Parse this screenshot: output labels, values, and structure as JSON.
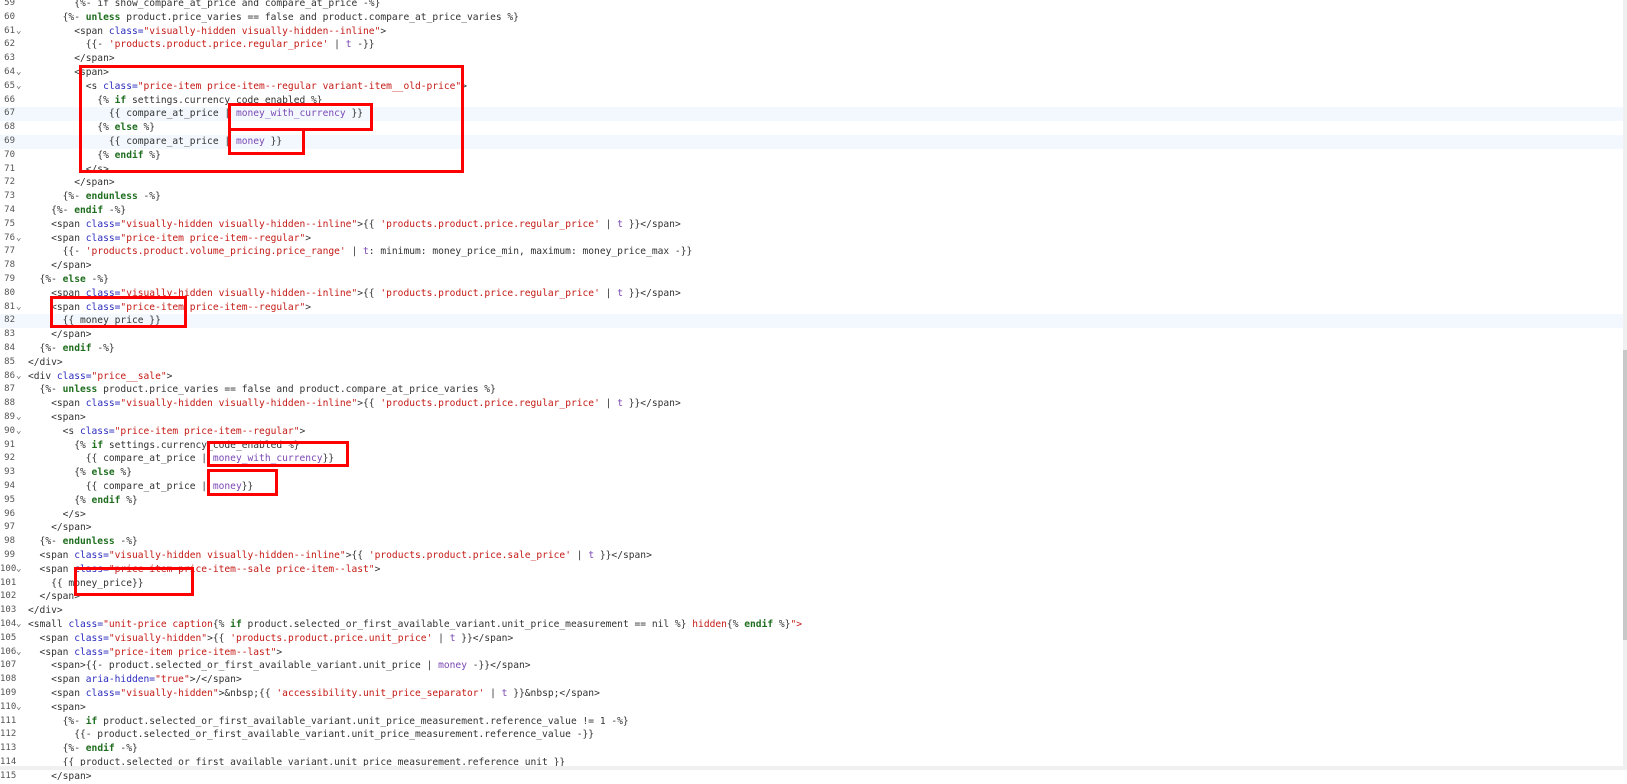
{
  "editor": {
    "lines": [
      {
        "n": "59",
        "fold": "",
        "hl": false,
        "segs": [
          [
            "        ",
            "liq"
          ],
          [
            "{%- if show_compare_at_price and compare_at_price -%}",
            "liq"
          ]
        ]
      },
      {
        "n": "60",
        "fold": "",
        "hl": false,
        "segs": [
          [
            "      {%- ",
            "liq"
          ],
          [
            "unless",
            "kw"
          ],
          [
            " product.price_varies == false and product.compare_at_price_varies %}",
            "liq"
          ]
        ]
      },
      {
        "n": "61",
        "fold": "⌄",
        "hl": false,
        "segs": [
          [
            "        <span ",
            "tag"
          ],
          [
            "class=",
            "attr"
          ],
          [
            "\"visually-hidden visually-hidden--inline\"",
            "str"
          ],
          [
            ">",
            "tag"
          ]
        ]
      },
      {
        "n": "62",
        "fold": "",
        "hl": false,
        "segs": [
          [
            "          {{- ",
            "liq"
          ],
          [
            "'products.product.price.regular_price'",
            "str"
          ],
          [
            " | ",
            "liq"
          ],
          [
            "t",
            "filter"
          ],
          [
            " -}}",
            "liq"
          ]
        ]
      },
      {
        "n": "63",
        "fold": "",
        "hl": false,
        "segs": [
          [
            "        </span>",
            "tag"
          ]
        ]
      },
      {
        "n": "64",
        "fold": "⌄",
        "hl": false,
        "segs": [
          [
            "        <span>",
            "tag"
          ]
        ]
      },
      {
        "n": "65",
        "fold": "⌄",
        "hl": false,
        "segs": [
          [
            "          <s ",
            "tag"
          ],
          [
            "class=",
            "attr"
          ],
          [
            "\"price-item price-item--regular variant-item__old-price\"",
            "str"
          ],
          [
            ">",
            "tag"
          ]
        ]
      },
      {
        "n": "66",
        "fold": "",
        "hl": false,
        "segs": [
          [
            "            {% ",
            "liq"
          ],
          [
            "if",
            "kw"
          ],
          [
            " settings.currency_code_enabled %}",
            "liq"
          ]
        ]
      },
      {
        "n": "67",
        "fold": "",
        "hl": true,
        "segs": [
          [
            "              {{ compare_at_price | ",
            "liq"
          ],
          [
            "money_with_currency",
            "filter"
          ],
          [
            " }}",
            "liq"
          ]
        ]
      },
      {
        "n": "68",
        "fold": "",
        "hl": false,
        "segs": [
          [
            "            {% ",
            "liq"
          ],
          [
            "else",
            "kw"
          ],
          [
            " %}",
            "liq"
          ]
        ]
      },
      {
        "n": "69",
        "fold": "",
        "hl": true,
        "segs": [
          [
            "              {{ compare_at_price | ",
            "liq"
          ],
          [
            "money",
            "filter"
          ],
          [
            " }}",
            "liq"
          ]
        ]
      },
      {
        "n": "70",
        "fold": "",
        "hl": false,
        "segs": [
          [
            "            {% ",
            "liq"
          ],
          [
            "endif",
            "kw"
          ],
          [
            " %}",
            "liq"
          ]
        ]
      },
      {
        "n": "71",
        "fold": "",
        "hl": false,
        "segs": [
          [
            "          </s>",
            "tag"
          ]
        ]
      },
      {
        "n": "72",
        "fold": "",
        "hl": false,
        "segs": [
          [
            "        </span>",
            "tag"
          ]
        ]
      },
      {
        "n": "73",
        "fold": "",
        "hl": false,
        "segs": [
          [
            "      {%- ",
            "liq"
          ],
          [
            "endunless",
            "kw"
          ],
          [
            " -%}",
            "liq"
          ]
        ]
      },
      {
        "n": "74",
        "fold": "",
        "hl": false,
        "segs": [
          [
            "    {%- ",
            "liq"
          ],
          [
            "endif",
            "kw"
          ],
          [
            " -%}",
            "liq"
          ]
        ]
      },
      {
        "n": "75",
        "fold": "",
        "hl": false,
        "segs": [
          [
            "    <span ",
            "tag"
          ],
          [
            "class=",
            "attr"
          ],
          [
            "\"visually-hidden visually-hidden--inline\"",
            "str"
          ],
          [
            ">{{ ",
            "tag"
          ],
          [
            "'products.product.price.regular_price'",
            "str"
          ],
          [
            " | ",
            "liq"
          ],
          [
            "t",
            "filter"
          ],
          [
            " }}</span>",
            "tag"
          ]
        ]
      },
      {
        "n": "76",
        "fold": "⌄",
        "hl": false,
        "segs": [
          [
            "    <span ",
            "tag"
          ],
          [
            "class=",
            "attr"
          ],
          [
            "\"price-item price-item--regular\"",
            "str"
          ],
          [
            ">",
            "tag"
          ]
        ]
      },
      {
        "n": "77",
        "fold": "",
        "hl": false,
        "segs": [
          [
            "      {{- ",
            "liq"
          ],
          [
            "'products.product.volume_pricing.price_range'",
            "str"
          ],
          [
            " | ",
            "liq"
          ],
          [
            "t",
            "filter"
          ],
          [
            ": minimum: money_price_min, maximum: money_price_max -}}",
            "liq"
          ]
        ]
      },
      {
        "n": "78",
        "fold": "",
        "hl": false,
        "segs": [
          [
            "    </span>",
            "tag"
          ]
        ]
      },
      {
        "n": "79",
        "fold": "",
        "hl": false,
        "segs": [
          [
            "  {%- ",
            "liq"
          ],
          [
            "else",
            "kw"
          ],
          [
            " -%}",
            "liq"
          ]
        ]
      },
      {
        "n": "80",
        "fold": "",
        "hl": false,
        "segs": [
          [
            "    <span ",
            "tag"
          ],
          [
            "class=",
            "attr"
          ],
          [
            "\"visually-hidden visually-hidden--inline\"",
            "str"
          ],
          [
            ">{{ ",
            "tag"
          ],
          [
            "'products.product.price.regular_price'",
            "str"
          ],
          [
            " | ",
            "liq"
          ],
          [
            "t",
            "filter"
          ],
          [
            " }}</span>",
            "tag"
          ]
        ]
      },
      {
        "n": "81",
        "fold": "⌄",
        "hl": false,
        "segs": [
          [
            "    <span ",
            "tag"
          ],
          [
            "class=",
            "attr"
          ],
          [
            "\"price-item price-item--regular\"",
            "str"
          ],
          [
            ">",
            "tag"
          ]
        ]
      },
      {
        "n": "82",
        "fold": "",
        "hl": true,
        "segs": [
          [
            "      {{ money_price }}",
            "liq"
          ]
        ]
      },
      {
        "n": "83",
        "fold": "",
        "hl": false,
        "segs": [
          [
            "    </span>",
            "tag"
          ]
        ]
      },
      {
        "n": "84",
        "fold": "",
        "hl": false,
        "segs": [
          [
            "  {%- ",
            "liq"
          ],
          [
            "endif",
            "kw"
          ],
          [
            " -%}",
            "liq"
          ]
        ]
      },
      {
        "n": "85",
        "fold": "",
        "hl": false,
        "segs": [
          [
            "</div>",
            "tag"
          ]
        ]
      },
      {
        "n": "86",
        "fold": "⌄",
        "hl": false,
        "segs": [
          [
            "<div ",
            "tag"
          ],
          [
            "class=",
            "attr"
          ],
          [
            "\"price__sale\"",
            "str"
          ],
          [
            ">",
            "tag"
          ]
        ]
      },
      {
        "n": "87",
        "fold": "",
        "hl": false,
        "segs": [
          [
            "  {%- ",
            "liq"
          ],
          [
            "unless",
            "kw"
          ],
          [
            " product.price_varies == false and product.compare_at_price_varies %}",
            "liq"
          ]
        ]
      },
      {
        "n": "88",
        "fold": "",
        "hl": false,
        "segs": [
          [
            "    <span ",
            "tag"
          ],
          [
            "class=",
            "attr"
          ],
          [
            "\"visually-hidden visually-hidden--inline\"",
            "str"
          ],
          [
            ">{{ ",
            "tag"
          ],
          [
            "'products.product.price.regular_price'",
            "str"
          ],
          [
            " | ",
            "liq"
          ],
          [
            "t",
            "filter"
          ],
          [
            " }}</span>",
            "tag"
          ]
        ]
      },
      {
        "n": "89",
        "fold": "⌄",
        "hl": false,
        "segs": [
          [
            "    <span>",
            "tag"
          ]
        ]
      },
      {
        "n": "90",
        "fold": "⌄",
        "hl": false,
        "segs": [
          [
            "      <s ",
            "tag"
          ],
          [
            "class=",
            "attr"
          ],
          [
            "\"price-item price-item--regular\"",
            "str"
          ],
          [
            ">",
            "tag"
          ]
        ]
      },
      {
        "n": "91",
        "fold": "",
        "hl": false,
        "segs": [
          [
            "        {% ",
            "liq"
          ],
          [
            "if",
            "kw"
          ],
          [
            " settings.currency_code_enabled %}",
            "liq"
          ]
        ]
      },
      {
        "n": "92",
        "fold": "",
        "hl": false,
        "segs": [
          [
            "          {{ compare_at_price | ",
            "liq"
          ],
          [
            "money_with_currency",
            "filter"
          ],
          [
            "}}",
            "liq"
          ]
        ]
      },
      {
        "n": "93",
        "fold": "",
        "hl": false,
        "segs": [
          [
            "        {% ",
            "liq"
          ],
          [
            "else",
            "kw"
          ],
          [
            " %}",
            "liq"
          ]
        ]
      },
      {
        "n": "94",
        "fold": "",
        "hl": false,
        "segs": [
          [
            "          {{ compare_at_price | ",
            "liq"
          ],
          [
            "money",
            "filter"
          ],
          [
            "}}",
            "liq"
          ]
        ]
      },
      {
        "n": "95",
        "fold": "",
        "hl": false,
        "segs": [
          [
            "        {% ",
            "liq"
          ],
          [
            "endif",
            "kw"
          ],
          [
            " %}",
            "liq"
          ]
        ]
      },
      {
        "n": "96",
        "fold": "",
        "hl": false,
        "segs": [
          [
            "      </s>",
            "tag"
          ]
        ]
      },
      {
        "n": "97",
        "fold": "",
        "hl": false,
        "segs": [
          [
            "    </span>",
            "tag"
          ]
        ]
      },
      {
        "n": "98",
        "fold": "",
        "hl": false,
        "segs": [
          [
            "  {%- ",
            "liq"
          ],
          [
            "endunless",
            "kw"
          ],
          [
            " -%}",
            "liq"
          ]
        ]
      },
      {
        "n": "99",
        "fold": "",
        "hl": false,
        "segs": [
          [
            "  <span ",
            "tag"
          ],
          [
            "class=",
            "attr"
          ],
          [
            "\"visually-hidden visually-hidden--inline\"",
            "str"
          ],
          [
            ">{{ ",
            "tag"
          ],
          [
            "'products.product.price.sale_price'",
            "str"
          ],
          [
            " | ",
            "liq"
          ],
          [
            "t",
            "filter"
          ],
          [
            " }}</span>",
            "tag"
          ]
        ]
      },
      {
        "n": "100",
        "fold": "⌄",
        "hl": false,
        "segs": [
          [
            "  <span ",
            "tag"
          ],
          [
            "class=",
            "attr"
          ],
          [
            "\"price-item price-item--sale price-item--last\"",
            "str"
          ],
          [
            ">",
            "tag"
          ]
        ]
      },
      {
        "n": "101",
        "fold": "",
        "hl": false,
        "segs": [
          [
            "    {{ money_price}}",
            "liq"
          ]
        ]
      },
      {
        "n": "102",
        "fold": "",
        "hl": false,
        "segs": [
          [
            "  </span>",
            "tag"
          ]
        ]
      },
      {
        "n": "103",
        "fold": "",
        "hl": false,
        "segs": [
          [
            "</div>",
            "tag"
          ]
        ]
      },
      {
        "n": "104",
        "fold": "⌄",
        "hl": false,
        "segs": [
          [
            "<small ",
            "tag"
          ],
          [
            "class=",
            "attr"
          ],
          [
            "\"unit-price caption",
            "str"
          ],
          [
            "{% ",
            "liq"
          ],
          [
            "if",
            "kw"
          ],
          [
            " product.selected_or_first_available_variant.unit_price_measurement == nil %} ",
            "liq"
          ],
          [
            "hidden",
            "str"
          ],
          [
            "{% ",
            "liq"
          ],
          [
            "endif",
            "kw"
          ],
          [
            " %}",
            "liq"
          ],
          [
            "\">",
            "str"
          ]
        ]
      },
      {
        "n": "105",
        "fold": "",
        "hl": false,
        "segs": [
          [
            "  <span ",
            "tag"
          ],
          [
            "class=",
            "attr"
          ],
          [
            "\"visually-hidden\"",
            "str"
          ],
          [
            ">{{ ",
            "tag"
          ],
          [
            "'products.product.price.unit_price'",
            "str"
          ],
          [
            " | ",
            "liq"
          ],
          [
            "t",
            "filter"
          ],
          [
            " }}</span>",
            "tag"
          ]
        ]
      },
      {
        "n": "106",
        "fold": "⌄",
        "hl": false,
        "segs": [
          [
            "  <span ",
            "tag"
          ],
          [
            "class=",
            "attr"
          ],
          [
            "\"price-item price-item--last\"",
            "str"
          ],
          [
            ">",
            "tag"
          ]
        ]
      },
      {
        "n": "107",
        "fold": "",
        "hl": false,
        "segs": [
          [
            "    <span>{{- product.selected_or_first_available_variant.unit_price | ",
            "tag"
          ],
          [
            "money",
            "filter"
          ],
          [
            " -}}</span>",
            "tag"
          ]
        ]
      },
      {
        "n": "108",
        "fold": "",
        "hl": false,
        "segs": [
          [
            "    <span ",
            "tag"
          ],
          [
            "aria-hidden=",
            "attr"
          ],
          [
            "\"true\"",
            "str"
          ],
          [
            ">/</span>",
            "tag"
          ]
        ]
      },
      {
        "n": "109",
        "fold": "",
        "hl": false,
        "segs": [
          [
            "    <span ",
            "tag"
          ],
          [
            "class=",
            "attr"
          ],
          [
            "\"visually-hidden\"",
            "str"
          ],
          [
            ">&nbsp;{{ ",
            "tag"
          ],
          [
            "'accessibility.unit_price_separator'",
            "str"
          ],
          [
            " | ",
            "liq"
          ],
          [
            "t",
            "filter"
          ],
          [
            " }}&nbsp;</span>",
            "tag"
          ]
        ]
      },
      {
        "n": "110",
        "fold": "⌄",
        "hl": false,
        "segs": [
          [
            "    <span>",
            "tag"
          ]
        ]
      },
      {
        "n": "111",
        "fold": "",
        "hl": false,
        "segs": [
          [
            "      {%- ",
            "liq"
          ],
          [
            "if",
            "kw"
          ],
          [
            " product.selected_or_first_available_variant.unit_price_measurement.reference_value != 1 -%}",
            "liq"
          ]
        ]
      },
      {
        "n": "112",
        "fold": "",
        "hl": false,
        "segs": [
          [
            "        {{- product.selected_or_first_available_variant.unit_price_measurement.reference_value -}}",
            "liq"
          ]
        ]
      },
      {
        "n": "113",
        "fold": "",
        "hl": false,
        "segs": [
          [
            "      {%- ",
            "liq"
          ],
          [
            "endif",
            "kw"
          ],
          [
            " -%}",
            "liq"
          ]
        ]
      },
      {
        "n": "114",
        "fold": "",
        "hl": false,
        "segs": [
          [
            "      {{ product.selected_or_first_available_variant.unit_price_measurement.reference_unit }}",
            "liq"
          ]
        ]
      },
      {
        "n": "115",
        "fold": "",
        "hl": false,
        "segs": [
          [
            "    </span>",
            "tag"
          ]
        ]
      }
    ]
  },
  "colors": {
    "annotation_box": "#ff0000",
    "line_highlight": "#f2f8fd"
  }
}
